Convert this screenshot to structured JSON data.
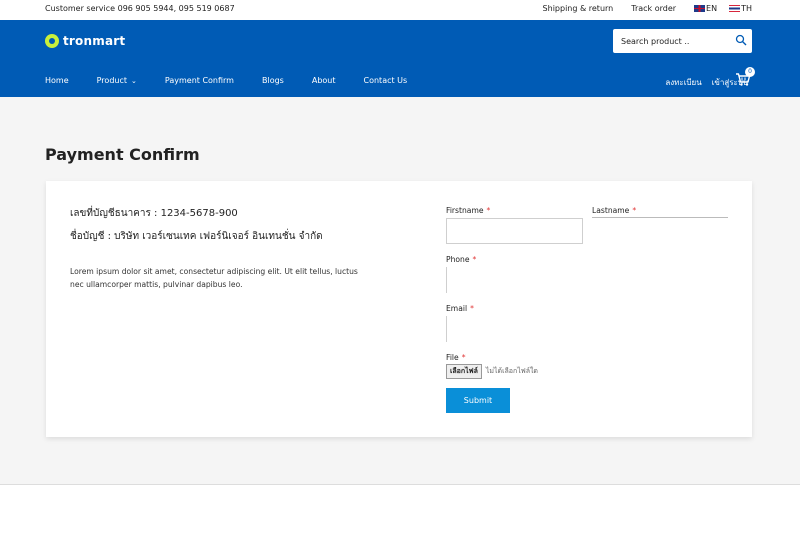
{
  "topbar": {
    "customer_service": "Customer service 096 905 5944, 095 519 0687",
    "shipping": "Shipping & return",
    "track": "Track order",
    "lang_en": "EN",
    "lang_th": "TH"
  },
  "header": {
    "logo": "tronmart",
    "search_placeholder": "Search product ..",
    "nav": {
      "home": "Home",
      "product": "Product",
      "payment": "Payment Confirm",
      "blogs": "Blogs",
      "about": "About",
      "contact": "Contact Us"
    },
    "register": "ลงทะเบียน",
    "login": "เข้าสู่ระบบ",
    "cart_count": "0"
  },
  "page": {
    "title": "Payment Confirm",
    "account_number": "เลขที่บัญชีธนาคาร : 1234-5678-900",
    "account_name": "ชื่อบัญชี : บริษัท เวอร์เซนเทค เฟอร์นิเจอร์ อินเทนชั่น จำกัด",
    "description": "Lorem ipsum dolor sit amet, consectetur adipiscing elit. Ut elit tellus, luctus nec ullamcorper mattis, pulvinar dapibus leo."
  },
  "form": {
    "firstname_label": "Firstname",
    "lastname_label": "Lastname",
    "phone_label": "Phone",
    "email_label": "Email",
    "file_label": "File",
    "required_mark": "*",
    "file_button": "เลือกไฟล์",
    "file_status": "ไม่ได้เลือกไฟล์ใด",
    "submit": "Submit"
  }
}
